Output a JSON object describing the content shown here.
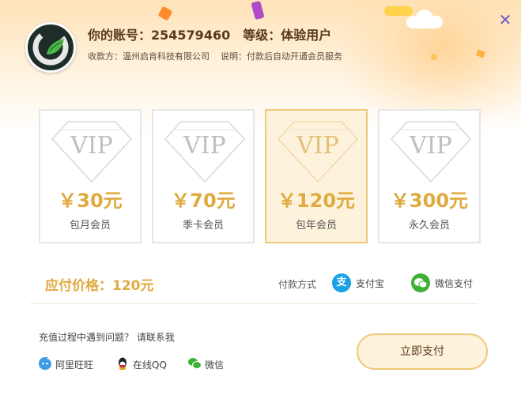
{
  "header": {
    "account_label": "你的账号：",
    "account_id": "254579460",
    "level_label": "等级：",
    "level_value": "体验用户",
    "payee": "收款方：温州启肯科技有限公司",
    "note": "说明：付款后自动开通会员服务"
  },
  "plans": [
    {
      "price": "￥30元",
      "name": "包月会员",
      "badge": "VIP",
      "selected": false
    },
    {
      "price": "￥70元",
      "name": "季卡会员",
      "badge": "VIP",
      "selected": false
    },
    {
      "price": "￥120元",
      "name": "包年会员",
      "badge": "VIP",
      "selected": true
    },
    {
      "price": "￥300元",
      "name": "永久会员",
      "badge": "VIP",
      "selected": false
    }
  ],
  "payment": {
    "amount_label": "应付价格：120元",
    "method_label": "付款方式",
    "alipay": "支付宝",
    "wechat": "微信支付"
  },
  "help": {
    "text": "充值过程中遇到问题？ 请联系我",
    "contacts": [
      "阿里旺旺",
      "在线QQ",
      "微信"
    ]
  },
  "pay_button": "立即支付",
  "colors": {
    "accent_gold": "#e0aa3f",
    "selected_bg": "#fdf2dc",
    "selected_border": "#f0c878",
    "alipay_blue": "#1aa1e6",
    "wechat_green": "#3eb135"
  },
  "icons": [
    "logo-icon",
    "close-icon",
    "alipay-icon",
    "wechat-pay-icon",
    "aliwangwang-icon",
    "qq-icon",
    "wechat-icon"
  ]
}
